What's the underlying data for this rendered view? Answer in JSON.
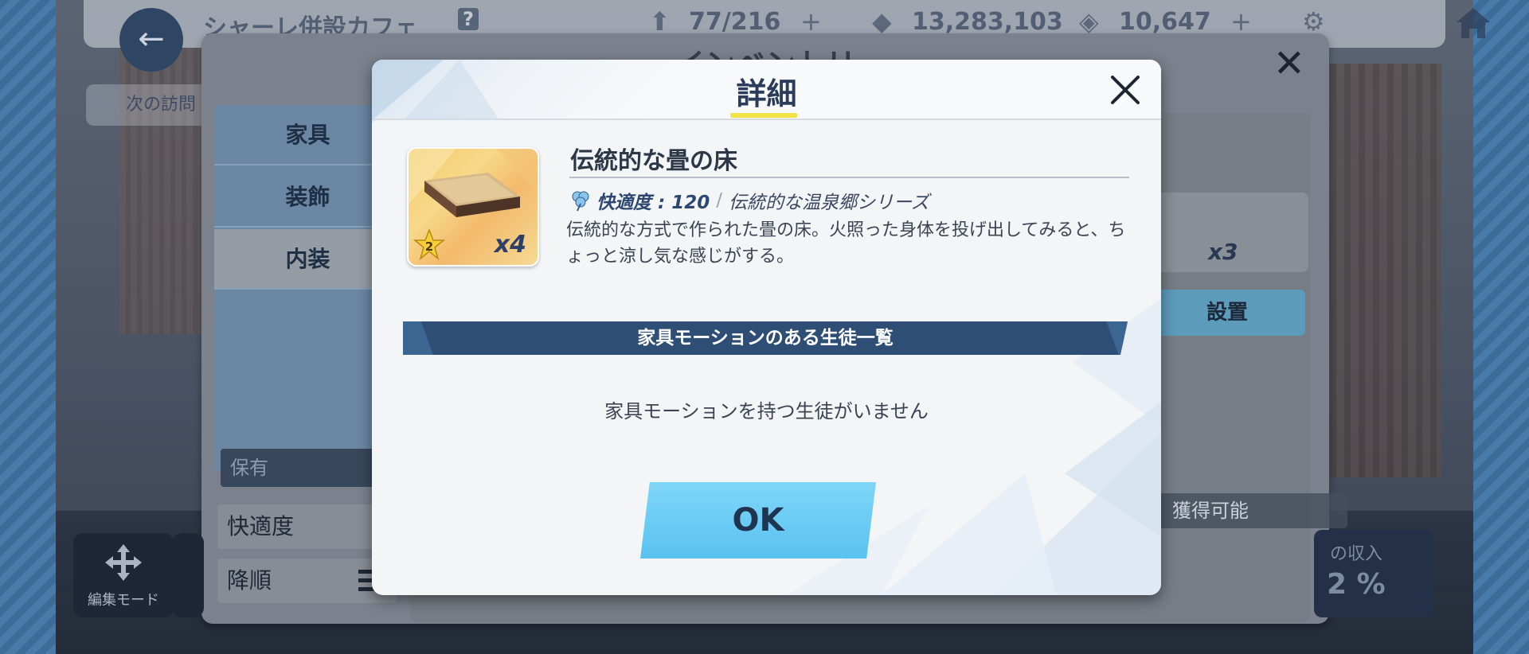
{
  "topbar": {
    "cafe_name": "シャーレ併設カフェ",
    "help_mark": "?",
    "visitors": "77/216",
    "credits": "13,283,103",
    "gems": "10,647"
  },
  "inventory": {
    "title": "インベントリ",
    "tabs": [
      "家具",
      "装飾",
      "内装"
    ],
    "hold_label": "保有",
    "sort_field": "快適度",
    "sort_order": "降順",
    "right_card_count": "x3",
    "place_button": "設置",
    "obtainable_label": "獲得可能",
    "income_label": "の収入",
    "income_value": "2 %",
    "edit_mode_label": "編集モード",
    "next_visit": "次の訪問"
  },
  "dialog": {
    "title": "詳細",
    "item": {
      "name": "伝統的な畳の床",
      "count": "x4",
      "rarity": "2",
      "comfort_label": "快適度 : 120",
      "series_separator": "/",
      "series": "伝統的な温泉郷シリーズ",
      "description": "伝統的な方式で作られた畳の床。火照った身体を投げ出してみると、ちょっと涼し気な感じがする。"
    },
    "motion_header": "家具モーションのある生徒一覧",
    "motion_empty": "家具モーションを持つ生徒がいません",
    "ok_button": "OK"
  },
  "colors": {
    "accent_blue": "#59c2f0",
    "banner_navy": "#2f4e76",
    "title_underline": "#f2e24a"
  }
}
